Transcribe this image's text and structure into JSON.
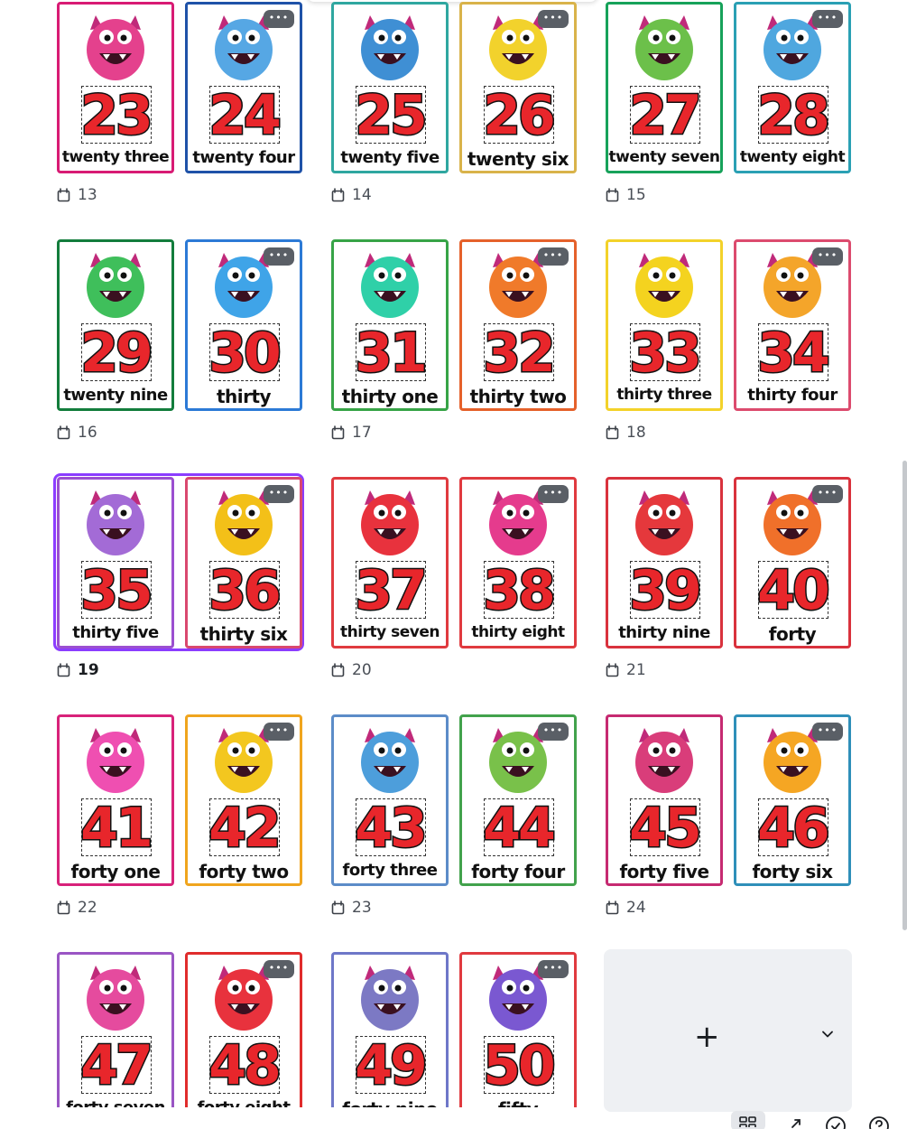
{
  "pages": [
    {
      "page_number": "13",
      "cards": [
        {
          "number": "23",
          "word": "twenty three",
          "color": "#d81b74",
          "monster": "#e4418d"
        },
        {
          "number": "24",
          "word": "twenty four",
          "color": "#1f52a8",
          "monster": "#56a7e4"
        }
      ]
    },
    {
      "page_number": "14",
      "cards": [
        {
          "number": "25",
          "word": "twenty five",
          "color": "#2fa7a0",
          "monster": "#3f8fd4"
        },
        {
          "number": "26",
          "word": "twenty six",
          "color": "#d9b34a",
          "monster": "#f2d22c"
        }
      ]
    },
    {
      "page_number": "15",
      "cards": [
        {
          "number": "27",
          "word": "twenty seven",
          "color": "#17a25a",
          "monster": "#6cc04a"
        },
        {
          "number": "28",
          "word": "twenty eight",
          "color": "#2aa0b4",
          "monster": "#4fa7df"
        }
      ]
    },
    {
      "page_number": "16",
      "cards": [
        {
          "number": "29",
          "word": "twenty nine",
          "color": "#137d3c",
          "monster": "#3fbf5b"
        },
        {
          "number": "30",
          "word": "thirty",
          "color": "#2c7ad6",
          "monster": "#3fa4e8"
        }
      ]
    },
    {
      "page_number": "17",
      "cards": [
        {
          "number": "31",
          "word": "thirty one",
          "color": "#37a447",
          "monster": "#2fd0a8"
        },
        {
          "number": "32",
          "word": "thirty two",
          "color": "#e5612b",
          "monster": "#f07a2a"
        }
      ]
    },
    {
      "page_number": "18",
      "cards": [
        {
          "number": "33",
          "word": "thirty three",
          "color": "#f3d22a",
          "monster": "#f4d31f"
        },
        {
          "number": "34",
          "word": "thirty four",
          "color": "#dc4b6e",
          "monster": "#f4a52a"
        }
      ]
    },
    {
      "page_number": "19",
      "cards": [
        {
          "number": "35",
          "word": "thirty five",
          "color": "#9b4fd0",
          "monster": "#a36bd6"
        },
        {
          "number": "36",
          "word": "thirty six",
          "color": "#d9486f",
          "monster": "#f3c018"
        }
      ]
    },
    {
      "page_number": "20",
      "cards": [
        {
          "number": "37",
          "word": "thirty seven",
          "color": "#e03a3f",
          "monster": "#e8323d"
        },
        {
          "number": "38",
          "word": "thirty eight",
          "color": "#e03a3f",
          "monster": "#e53b8d"
        }
      ]
    },
    {
      "page_number": "21",
      "cards": [
        {
          "number": "39",
          "word": "thirty nine",
          "color": "#d9323d",
          "monster": "#e5383c"
        },
        {
          "number": "40",
          "word": "forty",
          "color": "#d9323d",
          "monster": "#f0702a"
        }
      ]
    },
    {
      "page_number": "22",
      "cards": [
        {
          "number": "41",
          "word": "forty one",
          "color": "#d8227a",
          "monster": "#ef4fb1"
        },
        {
          "number": "42",
          "word": "forty two",
          "color": "#f0a51e",
          "monster": "#f3c71f"
        }
      ]
    },
    {
      "page_number": "23",
      "cards": [
        {
          "number": "43",
          "word": "forty three",
          "color": "#5c8cc8",
          "monster": "#4d9edb"
        },
        {
          "number": "44",
          "word": "forty four",
          "color": "#42a24c",
          "monster": "#79c14a"
        }
      ]
    },
    {
      "page_number": "24",
      "cards": [
        {
          "number": "45",
          "word": "forty five",
          "color": "#c62a71",
          "monster": "#d93d7a"
        },
        {
          "number": "46",
          "word": "forty six",
          "color": "#2f8fb9",
          "monster": "#f5a623"
        }
      ]
    },
    {
      "page_number": "",
      "cards": [
        {
          "number": "47",
          "word": "forty seven",
          "color": "#9a55c4",
          "monster": "#e54b9e"
        },
        {
          "number": "48",
          "word": "forty eight",
          "color": "#e02c2c",
          "monster": "#e8323d"
        }
      ]
    },
    {
      "page_number": "",
      "cards": [
        {
          "number": "49",
          "word": "forty nine",
          "color": "#6e77c8",
          "monster": "#7c79c4"
        },
        {
          "number": "50",
          "word": "fifty",
          "color": "#e03a3f",
          "monster": "#7a58d1"
        }
      ]
    }
  ],
  "selected_page": "19",
  "more_label": "•••",
  "add_page": {
    "plus": "+",
    "chevron": "chevron-down-icon"
  },
  "toolbar": {
    "icons": [
      "grid-view-icon",
      "expand-icon",
      "check-icon",
      "help-icon"
    ]
  }
}
